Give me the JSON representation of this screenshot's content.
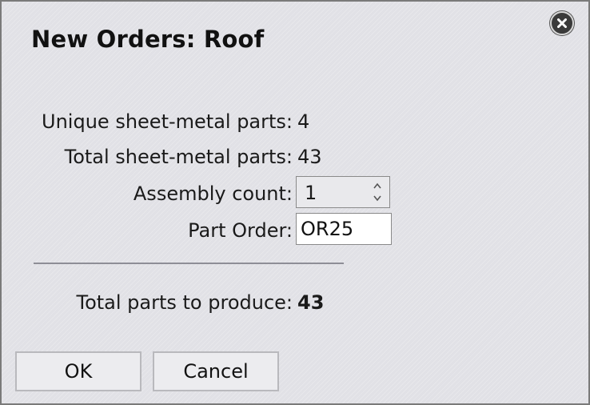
{
  "dialog": {
    "title": "New Orders: Roof",
    "close_icon": "close-circle-icon"
  },
  "stats": {
    "unique_label": "Unique sheet-metal parts:",
    "unique_value": "4",
    "total_label": "Total sheet-metal parts:",
    "total_value": "43"
  },
  "assembly": {
    "label": "Assembly count:",
    "value": "1",
    "spinner_icon": "spinner-arrows-icon"
  },
  "part_order": {
    "label": "Part Order:",
    "value": "OR25"
  },
  "summary": {
    "label": "Total parts to produce:",
    "value": "43"
  },
  "buttons": {
    "ok_label": "OK",
    "cancel_label": "Cancel"
  }
}
